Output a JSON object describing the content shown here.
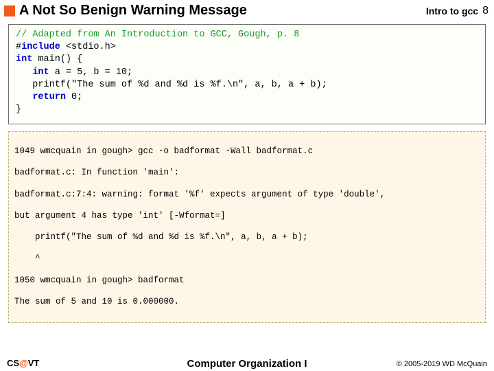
{
  "header": {
    "title": "A Not So Benign Warning Message",
    "module": "Intro to gcc",
    "page": "8"
  },
  "code": {
    "line1_comment": "// Adapted from An Introduction to GCC, Gough, p. 8",
    "line2_pre": "#",
    "line2_kw": "include",
    "line2_rest": " <stdio.h>",
    "blank": "",
    "line4_kw": "int",
    "line4_rest": " main() {",
    "line6_indent": "   ",
    "line6_kw": "int",
    "line6_rest": " a = 5, b = 10;",
    "line7": "   printf(\"The sum of %d and %d is %f.\\n\", a, b, a + b);",
    "line9_indent": "   ",
    "line9_kw": "return",
    "line9_rest": " 0;",
    "line10": "}"
  },
  "terminal": {
    "l1": "1049 wmcquain in gough> gcc -o badformat -Wall badformat.c",
    "l2": "badformat.c: In function 'main':",
    "l3": "badformat.c:7:4: warning: format '%f' expects argument of type 'double',",
    "l4": "but argument 4 has type 'int' [-Wformat=]",
    "l5": "    printf(\"The sum of %d and %d is %f.\\n\", a, b, a + b);",
    "l6": "    ^",
    "l7": "1050 wmcquain in gough> badformat",
    "l8": "The sum of 5 and 10 is 0.000000."
  },
  "footer": {
    "left_cs": "CS",
    "left_at": "@",
    "left_vt": "VT",
    "center": "Computer Organization I",
    "right": "© 2005-2019 WD McQuain"
  }
}
